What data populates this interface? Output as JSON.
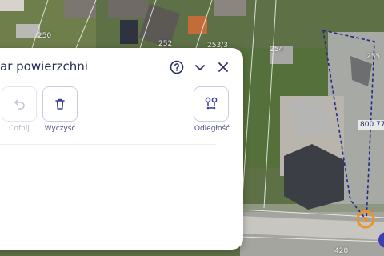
{
  "map": {
    "parcel_labels": [
      "250",
      "252",
      "253/3",
      "254",
      "255",
      "428"
    ],
    "measure_label": "800.77"
  },
  "panel": {
    "title": "ar powierzchni",
    "help_icon": "help-circle-icon",
    "collapse_icon": "chevron-down-icon",
    "close_icon": "close-icon",
    "tools": {
      "undo_label": "Cofnij",
      "clear_label": "Wyczyść",
      "distance_label": "Odległość"
    }
  },
  "colors": {
    "accent": "#3b3f8f",
    "measure_line": "#1f2a8c",
    "marker": "#f0922b"
  }
}
